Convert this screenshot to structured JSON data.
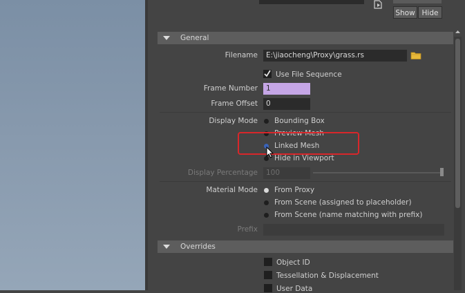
{
  "top_buttons": {
    "show": "Show",
    "hide": "Hide"
  },
  "sections": {
    "general": {
      "title": "General"
    },
    "overrides": {
      "title": "Overrides"
    }
  },
  "filename": {
    "label": "Filename",
    "value": "E:\\jiaocheng\\Proxy\\grass.rs"
  },
  "use_file_sequence": {
    "label": "Use File Sequence",
    "checked": true
  },
  "frame_number": {
    "label": "Frame Number",
    "value": "1"
  },
  "frame_offset": {
    "label": "Frame Offset",
    "value": "0"
  },
  "display_mode": {
    "label": "Display Mode",
    "options": [
      "Bounding Box",
      "Preview Mesh",
      "Linked Mesh",
      "Hide in Viewport"
    ],
    "selected": "Linked Mesh"
  },
  "display_percentage": {
    "label": "Display Percentage",
    "value": "100"
  },
  "material_mode": {
    "label": "Material Mode",
    "options": [
      "From Proxy",
      "From Scene (assigned to placeholder)",
      "From Scene (name matching with prefix)"
    ],
    "selected": "From Proxy"
  },
  "prefix": {
    "label": "Prefix",
    "value": ""
  },
  "overrides": [
    {
      "label": "Object ID",
      "checked": false
    },
    {
      "label": "Tessellation & Displacement",
      "checked": false
    },
    {
      "label": "User Data",
      "checked": false
    }
  ],
  "colors": {
    "highlight": "#d9262a",
    "frame_number_bg": "#c5a6e6",
    "radio_selected": "#3a63b8"
  }
}
